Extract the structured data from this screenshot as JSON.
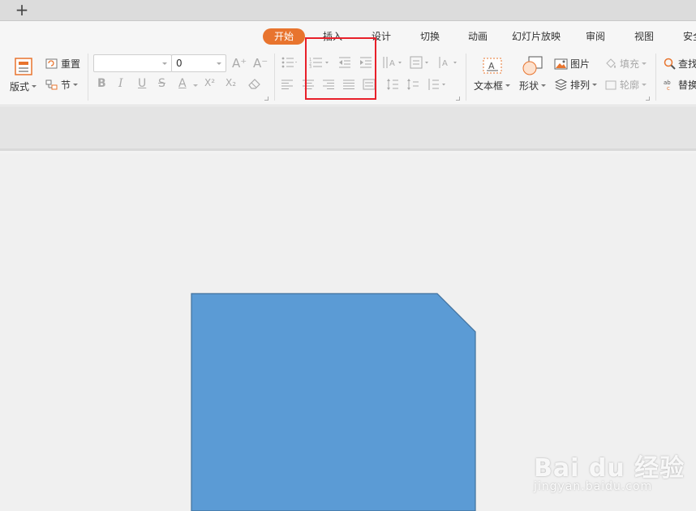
{
  "titlebar": {
    "new_tab": "+"
  },
  "ribbon": {
    "tabs": [
      {
        "label": "开始"
      },
      {
        "label": "插入"
      },
      {
        "label": "设计"
      },
      {
        "label": "切换"
      },
      {
        "label": "动画"
      },
      {
        "label": "幻灯片放映"
      },
      {
        "label": "审阅"
      },
      {
        "label": "视图"
      },
      {
        "label": "安全"
      }
    ],
    "layout_label": "版式",
    "reset_label": "重置",
    "section_label": "节",
    "font_name": "",
    "font_size": "0",
    "bold": "B",
    "italic": "I",
    "underline": "U",
    "strike": "S",
    "font_color": "A",
    "superscript": "X²",
    "subscript": "X₂",
    "textbox_label": "文本框",
    "shape_label": "形状",
    "picture_label": "图片",
    "arrange_label": "排列",
    "fill_label": "填充",
    "outline_label": "轮廓",
    "find_label": "查找",
    "replace_label": "替换",
    "grow_font": "A⁺",
    "shrink_font": "A⁻"
  },
  "colors": {
    "accent": "#e8742e",
    "shape_fill": "#5b9bd5",
    "shape_stroke": "#41719c",
    "highlight": "#e8202a"
  },
  "watermark": {
    "logo": "Bai du 经验",
    "url": "jingyan.baidu.com"
  }
}
